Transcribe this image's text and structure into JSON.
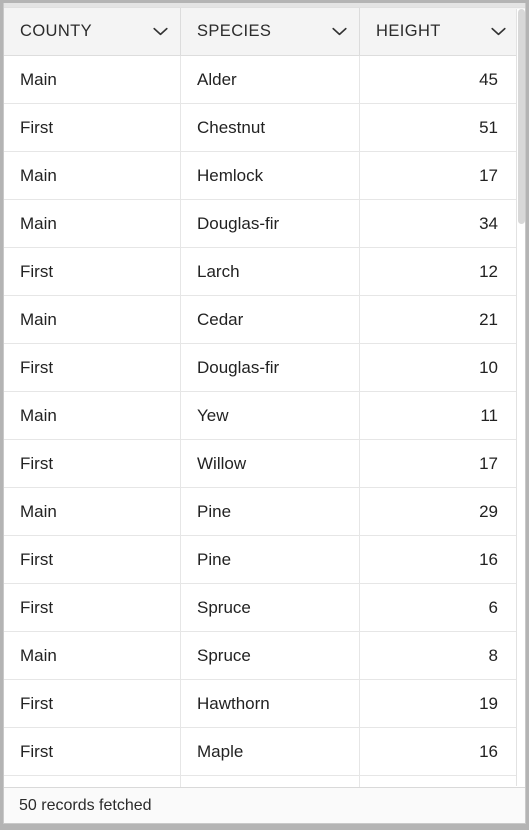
{
  "grid": {
    "columns": [
      {
        "label": "COUNTY",
        "align": "left",
        "sort_icon": "chevron-down-icon"
      },
      {
        "label": "SPECIES",
        "align": "left",
        "sort_icon": "chevron-down-icon"
      },
      {
        "label": "HEIGHT",
        "align": "right",
        "sort_icon": "chevron-down-icon"
      }
    ],
    "rows": [
      {
        "county": "Main",
        "species": "Alder",
        "height": "45"
      },
      {
        "county": "First",
        "species": "Chestnut",
        "height": "51"
      },
      {
        "county": "Main",
        "species": "Hemlock",
        "height": "17"
      },
      {
        "county": "Main",
        "species": "Douglas-fir",
        "height": "34"
      },
      {
        "county": "First",
        "species": "Larch",
        "height": "12"
      },
      {
        "county": "Main",
        "species": "Cedar",
        "height": "21"
      },
      {
        "county": "First",
        "species": "Douglas-fir",
        "height": "10"
      },
      {
        "county": "Main",
        "species": "Yew",
        "height": "11"
      },
      {
        "county": "First",
        "species": "Willow",
        "height": "17"
      },
      {
        "county": "Main",
        "species": "Pine",
        "height": "29"
      },
      {
        "county": "First",
        "species": "Pine",
        "height": "16"
      },
      {
        "county": "First",
        "species": "Spruce",
        "height": "6"
      },
      {
        "county": "Main",
        "species": "Spruce",
        "height": "8"
      },
      {
        "county": "First",
        "species": "Hawthorn",
        "height": "19"
      },
      {
        "county": "First",
        "species": "Maple",
        "height": "16"
      },
      {
        "county": "",
        "species": "",
        "height": ""
      }
    ]
  },
  "footer": {
    "status": "50 records fetched"
  },
  "colors": {
    "header_bg": "#f4f4f4",
    "row_bg": "#ffffff",
    "grid_line": "#e6e6e6",
    "text": "#222222",
    "footer_bg": "#fafafa",
    "window_bg": "#b4b4b4",
    "scrollbar_thumb": "#d8d8d8"
  }
}
